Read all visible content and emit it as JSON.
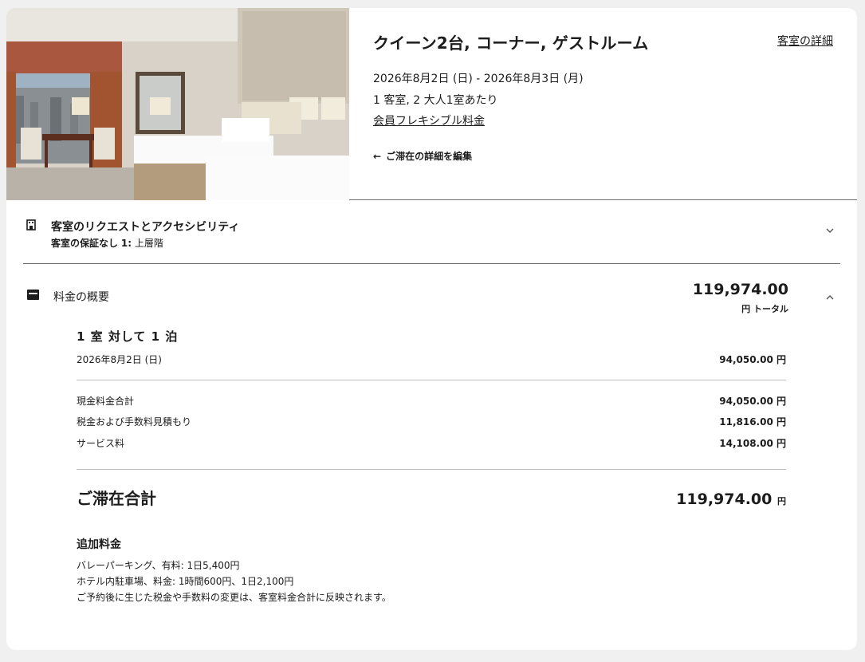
{
  "room": {
    "title": "クイーン2台, コーナー, ゲストルーム",
    "details_link": "客室の詳細",
    "dates": "2026年8月2日 (日) - 2026年8月3日 (月)",
    "occupancy": "1 客室, 2 大人1室あたり",
    "rate_name": "会員フレキシブル料金",
    "edit_label": "ご滞在の詳細を編集"
  },
  "requests": {
    "title": "客室のリクエストとアクセシビリティ",
    "guarantee_label": "客室の保証なし",
    "count_prefix": "1:",
    "request_value": "上層階"
  },
  "summary": {
    "title": "料金の概要",
    "total": "119,974.00",
    "total_sub": "円 トータル",
    "nights_heading": "1 室 対して 1 泊",
    "night_date": "2026年8月2日 (日)",
    "night_amount": "94,050.00 円",
    "lines": [
      {
        "label": "現金料金合計",
        "amount": "94,050.00 円"
      },
      {
        "label": "税金および手数料見積もり",
        "amount": "11,816.00 円"
      },
      {
        "label": "サービス料",
        "amount": "14,108.00 円"
      }
    ],
    "grand_label": "ご滞在合計",
    "grand_amount": "119,974.00",
    "grand_unit": "円"
  },
  "extras": {
    "title": "追加料金",
    "lines": [
      "バレーパーキング、有料: 1日5,400円",
      "ホテル内駐車場、料金: 1時間600円、1日2,100円",
      "ご予約後に生じた税金や手数料の変更は、客室料金合計に反映されます。"
    ]
  },
  "icons": {
    "edit_arrow": "left-arrow-icon",
    "requests": "building-icon",
    "summary": "wallet-icon",
    "requests_toggle": "chevron-down-icon",
    "summary_toggle": "chevron-up-icon"
  }
}
